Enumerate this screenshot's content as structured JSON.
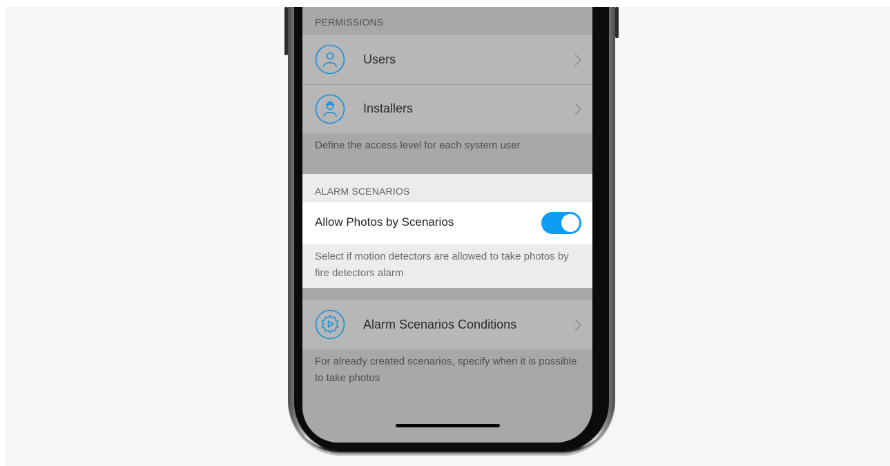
{
  "permissions": {
    "header": "PERMISSIONS",
    "items": [
      {
        "label": "Users",
        "icon": "user-icon"
      },
      {
        "label": "Installers",
        "icon": "installer-icon"
      }
    ],
    "footnote": "Define the access level for each system user"
  },
  "alarm_scenarios": {
    "header": "ALARM SCENARIOS",
    "allow_photos": {
      "label": "Allow Photos by Scenarios",
      "enabled": true
    },
    "footnote": "Select if motion detectors are allowed to take photos by fire detectors alarm"
  },
  "conditions": {
    "label": "Alarm Scenarios Conditions",
    "icon": "scenario-gear-play-icon",
    "footnote": "For already created scenarios, specify when it is possible to take photos"
  },
  "colors": {
    "accent": "#0f9cf3",
    "icon_blue": "#1a8fd6",
    "dimmed_background": "#a8a8a8",
    "highlight_background": "#ececec"
  }
}
